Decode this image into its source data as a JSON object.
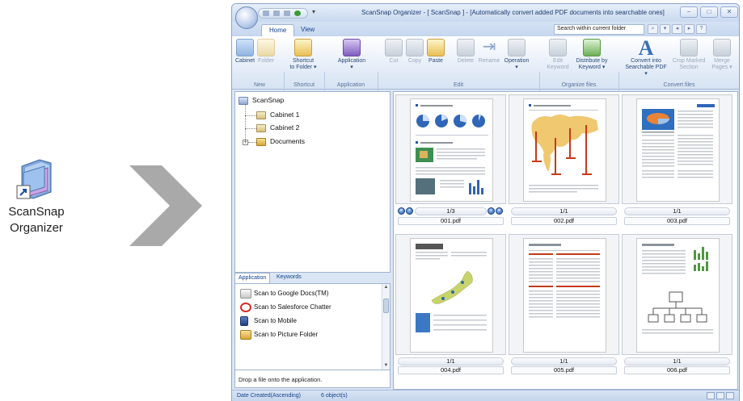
{
  "desktop_icon": {
    "label_line1": "ScanSnap",
    "label_line2": "Organizer"
  },
  "window": {
    "title": "ScanSnap Organizer - [ ScanSnap ] - [Automatically convert added PDF documents into searchable ones]",
    "controls": {
      "minimize": "−",
      "maximize": "□",
      "close": "✕"
    }
  },
  "tabs": [
    {
      "label": "Home"
    },
    {
      "label": "View"
    }
  ],
  "search": {
    "placeholder": "Search within current folder"
  },
  "ribbon": {
    "buttons": [
      {
        "label": "Cabinet",
        "label2": ""
      },
      {
        "label": "Folder",
        "label2": ""
      },
      {
        "label": "Shortcut",
        "label2": "to Folder ▾"
      },
      {
        "label": "Application",
        "label2": "▾"
      },
      {
        "label": "Cut",
        "label2": ""
      },
      {
        "label": "Copy",
        "label2": ""
      },
      {
        "label": "Paste",
        "label2": ""
      },
      {
        "label": "Delete",
        "label2": ""
      },
      {
        "label": "Rename",
        "label2": ""
      },
      {
        "label": "Operation",
        "label2": "▾"
      },
      {
        "label": "Edit",
        "label2": "Keyword"
      },
      {
        "label": "Distribute by",
        "label2": "Keyword ▾"
      },
      {
        "label": "Convert into",
        "label2": "Searchable PDF ▾"
      },
      {
        "label": "Crop Marked",
        "label2": "Section"
      },
      {
        "label": "Merge",
        "label2": "Pages ▾"
      }
    ],
    "groups": [
      "New",
      "Shortcut",
      "Application",
      "Edit",
      "Organize files",
      "Convert files"
    ]
  },
  "tree": {
    "root": "ScanSnap",
    "items": [
      "Cabinet 1",
      "Cabinet 2",
      "Documents"
    ]
  },
  "app_panel": {
    "tabs": [
      "Application",
      "Keywords"
    ],
    "items": [
      "Scan to Google Docs(TM)",
      "Scan to Salesforce Chatter",
      "Scan to Mobile",
      "Scan to Picture Folder"
    ],
    "hint": "Drop a file onto the application."
  },
  "thumbnails": [
    {
      "page": "1/3",
      "name": "001.pdf"
    },
    {
      "page": "1/1",
      "name": "002.pdf"
    },
    {
      "page": "1/1",
      "name": "003.pdf"
    },
    {
      "page": "1/1",
      "name": "004.pdf"
    },
    {
      "page": "1/1",
      "name": "005.pdf"
    },
    {
      "page": "1/1",
      "name": "006.pdf"
    }
  ],
  "status": {
    "sort": "Date Created(Ascending)",
    "count": "6 object(s)"
  }
}
